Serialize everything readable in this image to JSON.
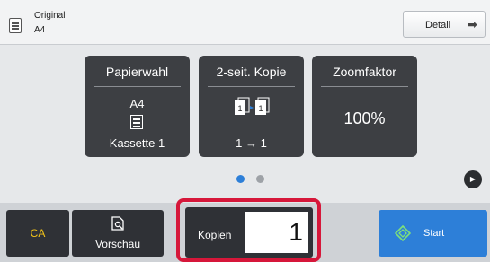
{
  "original": {
    "label": "Original",
    "size": "A4"
  },
  "detail": {
    "label": "Detail"
  },
  "tiles": {
    "paper": {
      "title": "Papierwahl",
      "size": "A4",
      "tray": "Kassette 1"
    },
    "duplex": {
      "title": "2-seit. Kopie",
      "value": "1 → 1",
      "icon_digits": [
        "1",
        "1"
      ]
    },
    "zoom": {
      "title": "Zoomfaktor",
      "value": "100%"
    }
  },
  "bottom": {
    "ca": "CA",
    "preview": "Vorschau",
    "copies_label": "Kopien",
    "copies_value": "1",
    "start": "Start"
  },
  "colors": {
    "accent": "#2d7fd8",
    "highlight": "#d6173a",
    "ca_text": "#f5c518",
    "tile": "#3d3f43"
  }
}
